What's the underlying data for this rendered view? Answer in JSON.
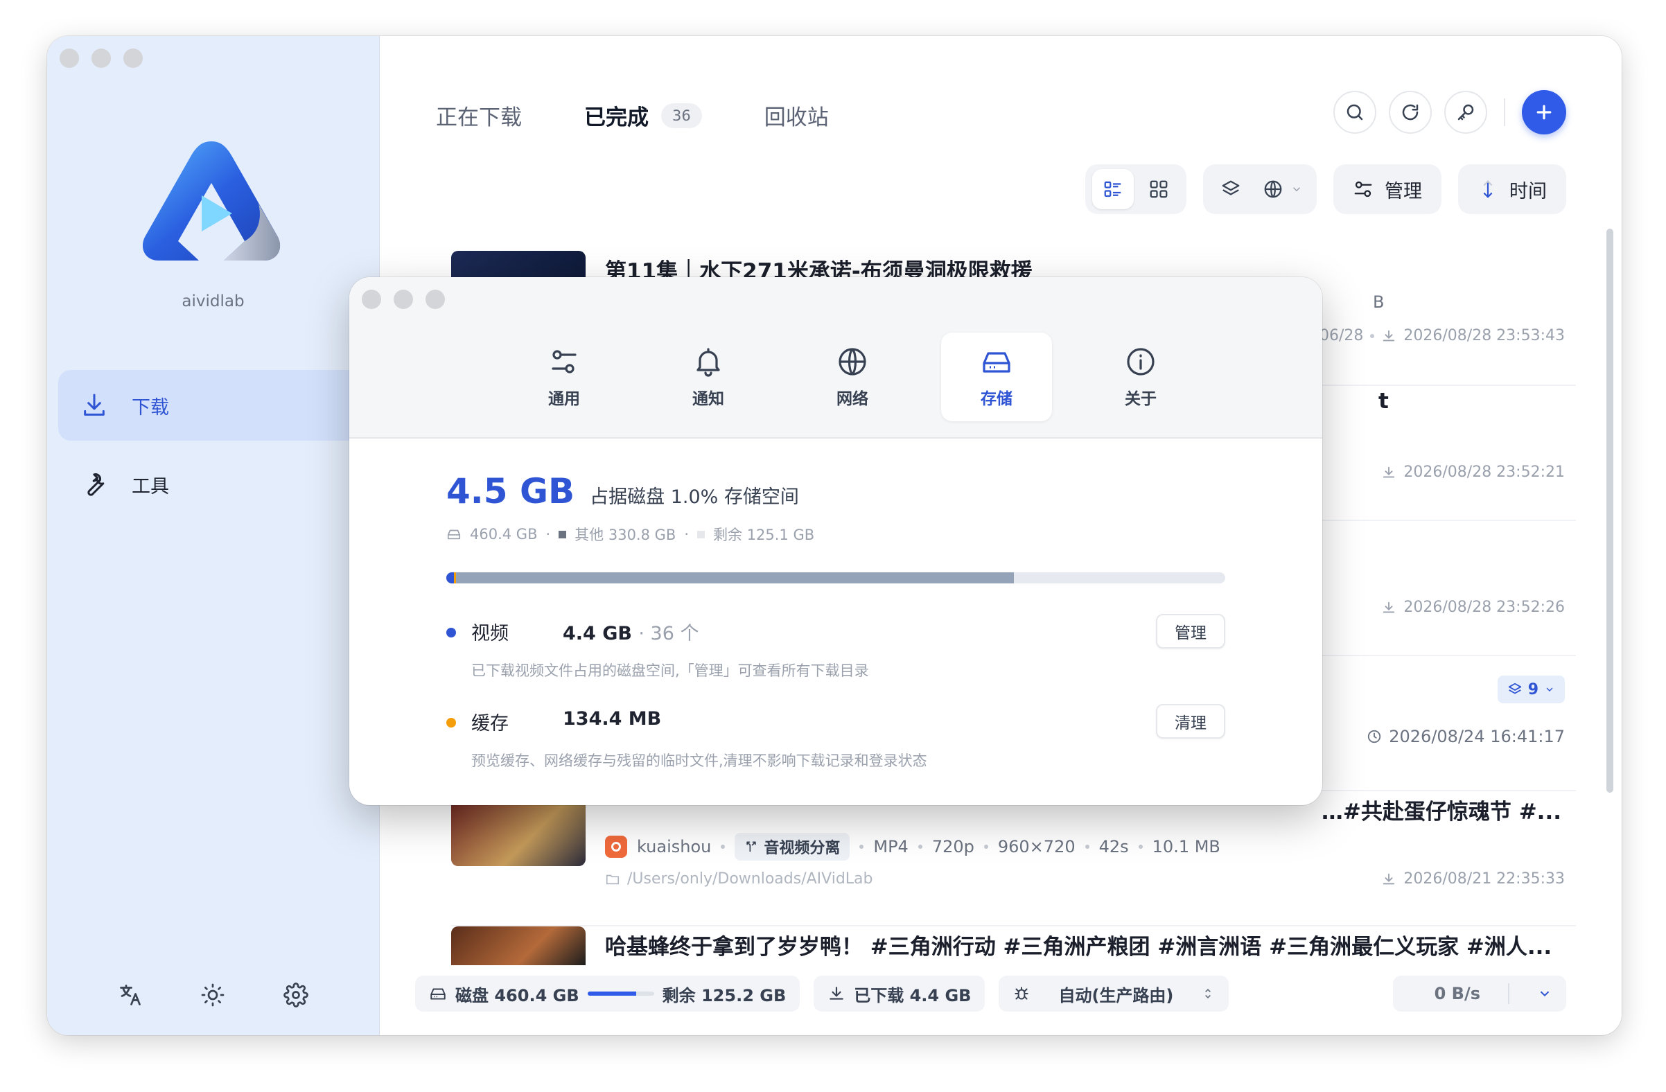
{
  "app": {
    "brand": "aividlab"
  },
  "sidebar": {
    "items": [
      {
        "label": "下载",
        "icon": "download-icon",
        "active": true
      },
      {
        "label": "工具",
        "icon": "wrench-icon",
        "active": false
      }
    ],
    "bottom_icons": [
      "translate-icon",
      "sun-icon",
      "gear-icon"
    ]
  },
  "tabs": [
    {
      "label": "正在下载"
    },
    {
      "label": "已完成",
      "badge": "36",
      "active": true
    },
    {
      "label": "回收站"
    }
  ],
  "toolbar": {
    "manage_label": "管理",
    "sort_label": "时间"
  },
  "list": [
    {
      "title": "第11集｜水下271米承诺-布须曼洞极限救援",
      "meta_fragment": "B",
      "date_fragment": "06/28",
      "date": "2026/08/28 23:53:43"
    },
    {
      "title_fragment": "t",
      "date": "2026/08/28 23:52:21"
    },
    {
      "date": "2026/08/28 23:52:26"
    },
    {
      "layers_count": "9",
      "date": "2026/08/24 16:41:17"
    },
    {
      "title": "…#共赴蛋仔惊魂节 #...",
      "source": "kuaishou",
      "tag": "音视频分离",
      "format": "MP4",
      "quality": "720p",
      "resolution": "960×720",
      "duration": "42s",
      "size": "10.1 MB",
      "path": "/Users/only/Downloads/AIVidLab",
      "date": "2026/08/21 22:35:33"
    },
    {
      "title": "哈基蜂终于拿到了岁岁鸭！ #三角洲行动 #三角洲产粮团 #洲言洲语 #三角洲最仁义玩家 #洲人..."
    }
  ],
  "statusbar": {
    "disk_label": "磁盘 460.4 GB",
    "disk_fraction": 0.73,
    "free_label": "剩余 125.2 GB",
    "downloaded_label": "已下载 4.4 GB",
    "route_label": "自动(生产路由)",
    "speed": "0 B/s"
  },
  "settings": {
    "tabs": [
      {
        "label": "通用",
        "icon": "sliders-icon"
      },
      {
        "label": "通知",
        "icon": "bell-icon"
      },
      {
        "label": "网络",
        "icon": "globe-icon"
      },
      {
        "label": "存储",
        "icon": "hard-drive-icon",
        "active": true
      },
      {
        "label": "关于",
        "icon": "info-icon"
      }
    ],
    "storage": {
      "total_used": "4.5 GB",
      "desc": "占据磁盘 1.0% 存储空间",
      "disk_total": "460.4 GB",
      "other": "其他 330.8 GB",
      "free": "剩余 125.1 GB",
      "bar": {
        "video_fraction": 0.0096,
        "cache_fraction": 0.0003,
        "used_fraction": 0.7286
      },
      "video": {
        "name": "视频",
        "size": "4.4 GB",
        "count": "· 36 个",
        "hint": "已下载视频文件占用的磁盘空间,「管理」可查看所有下载目录",
        "button": "管理",
        "color": "#2f55d4"
      },
      "cache": {
        "name": "缓存",
        "size": "134.4 MB",
        "hint": "预览缓存、网络缓存与残留的临时文件,清理不影响下载记录和登录状态",
        "button": "清理",
        "color": "#f59e0b"
      }
    }
  }
}
